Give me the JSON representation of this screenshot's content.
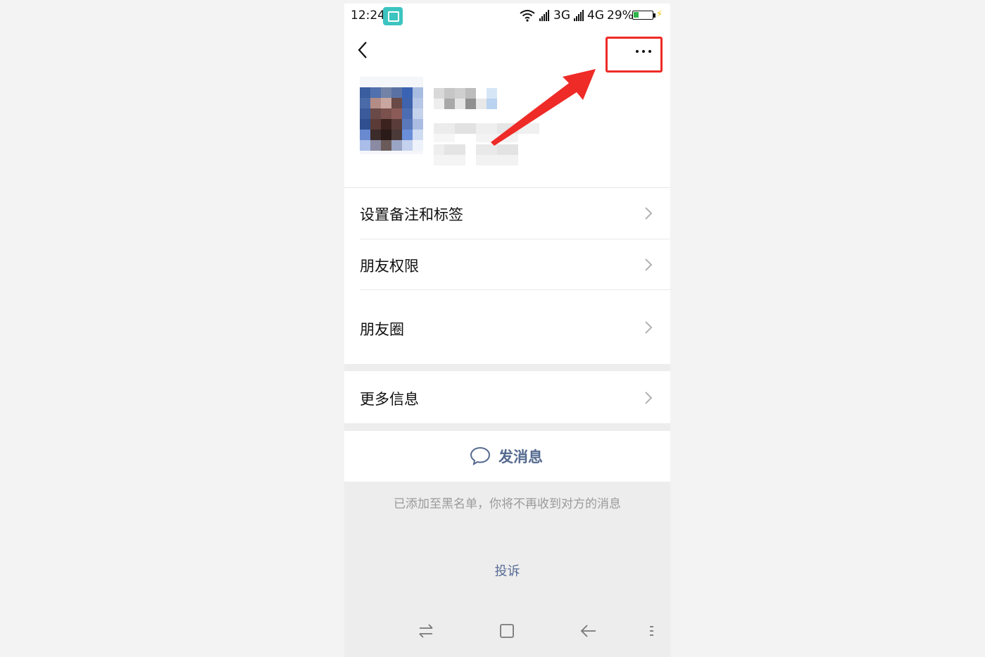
{
  "status_bar": {
    "time": "12:24",
    "network1": "3G",
    "network2": "4G",
    "battery": "29%",
    "battery_level": 0.29
  },
  "icons": {
    "back": "back-arrow-icon",
    "more": "more-dots-icon",
    "chat": "chat-bubble-icon"
  },
  "menu": {
    "remark_tags": "设置备注和标签",
    "permissions": "朋友权限",
    "moments": "朋友圈",
    "more_info": "更多信息"
  },
  "actions": {
    "send_message": "发消息",
    "blacklist_notice": "已添加至黑名单，你将不再收到对方的消息",
    "complain": "投诉"
  },
  "colors": {
    "annotation": "#ee2b27",
    "link": "#576b95",
    "battery_fill": "#2fb54a"
  }
}
